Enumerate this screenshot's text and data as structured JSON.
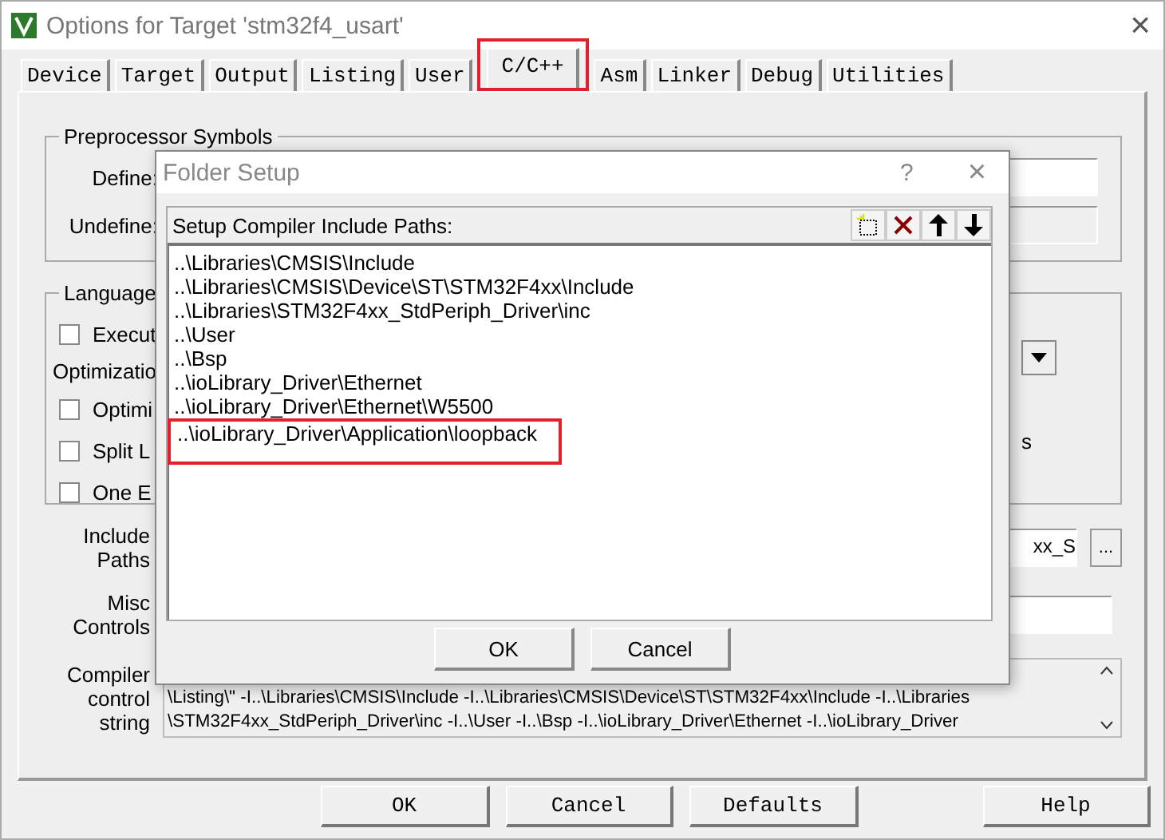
{
  "window": {
    "title": "Options for Target 'stm32f4_usart'",
    "close": "×"
  },
  "tabs": [
    {
      "label": "Device",
      "selected": false,
      "highlighted": false
    },
    {
      "label": "Target",
      "selected": false,
      "highlighted": false
    },
    {
      "label": "Output",
      "selected": false,
      "highlighted": false
    },
    {
      "label": "Listing",
      "selected": false,
      "highlighted": false
    },
    {
      "label": "User",
      "selected": false,
      "highlighted": false
    },
    {
      "label": "C/C++",
      "selected": true,
      "highlighted": true
    },
    {
      "label": "Asm",
      "selected": false,
      "highlighted": false
    },
    {
      "label": "Linker",
      "selected": false,
      "highlighted": false
    },
    {
      "label": "Debug",
      "selected": false,
      "highlighted": false
    },
    {
      "label": "Utilities",
      "selected": false,
      "highlighted": false
    }
  ],
  "preprocessor": {
    "title": "Preprocessor Symbols",
    "define_label": "Define:",
    "undefine_label": "Undefine:"
  },
  "language": {
    "title": "Language",
    "first_option": {
      "label": "Execut",
      "checked": false
    },
    "optimization_label": "Optimizatio",
    "options": [
      {
        "label": "Optimi",
        "checked": false
      },
      {
        "label": "Split L",
        "checked": false
      },
      {
        "label": "One E",
        "checked": false
      }
    ],
    "side_text": "s"
  },
  "include_paths": {
    "label": "Include Paths",
    "value": "xx_S",
    "browse": "..."
  },
  "misc_controls": {
    "label": "Misc Controls"
  },
  "compiler_control": {
    "label": "Compiler control string",
    "lines": [
      "\\Listing\\\" -I..\\Libraries\\CMSIS\\Include -I..\\Libraries\\CMSIS\\Device\\ST\\STM32F4xx\\Include -I..\\Libraries",
      "\\STM32F4xx_StdPeriph_Driver\\inc -I..\\User -I..\\Bsp -I..\\ioLibrary_Driver\\Ethernet -I..\\ioLibrary_Driver"
    ]
  },
  "buttons": [
    "OK",
    "Cancel",
    "Defaults",
    "Help"
  ],
  "folder_setup": {
    "title": "Folder Setup",
    "help": "?",
    "close": "×",
    "list_label": "Setup Compiler Include Paths:",
    "paths": [
      {
        "text": "..\\Libraries\\CMSIS\\Include",
        "highlighted": false
      },
      {
        "text": "..\\Libraries\\CMSIS\\Device\\ST\\STM32F4xx\\Include",
        "highlighted": false
      },
      {
        "text": "..\\Libraries\\STM32F4xx_StdPeriph_Driver\\inc",
        "highlighted": false
      },
      {
        "text": "..\\User",
        "highlighted": false
      },
      {
        "text": "..\\Bsp",
        "highlighted": false
      },
      {
        "text": "..\\ioLibrary_Driver\\Ethernet",
        "highlighted": false
      },
      {
        "text": "..\\ioLibrary_Driver\\Ethernet\\W5500",
        "highlighted": false
      },
      {
        "text": "..\\ioLibrary_Driver\\Application\\loopback",
        "highlighted": true
      }
    ],
    "buttons": [
      "OK",
      "Cancel"
    ]
  }
}
